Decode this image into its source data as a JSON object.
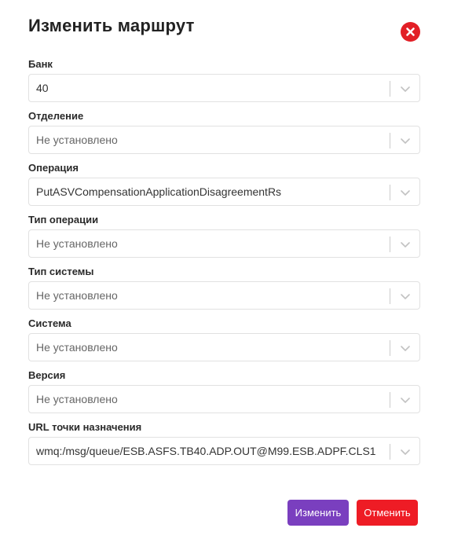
{
  "dialog": {
    "title": "Изменить маршрут",
    "close_icon": "close-icon",
    "accent_colors": {
      "close": "#e21f26",
      "primary": "#7a3fbf",
      "danger": "#ee1c25"
    }
  },
  "fields": [
    {
      "label": "Банк",
      "value": "40"
    },
    {
      "label": "Отделение",
      "placeholder": "Не установлено"
    },
    {
      "label": "Операция",
      "value": "PutASVCompensationApplicationDisagreementRs"
    },
    {
      "label": "Тип операции",
      "placeholder": "Не установлено"
    },
    {
      "label": "Тип системы",
      "placeholder": "Не установлено"
    },
    {
      "label": "Система",
      "placeholder": "Не установлено"
    },
    {
      "label": "Версия",
      "placeholder": "Не установлено"
    },
    {
      "label": "URL точки назначения",
      "value": "wmq:/msg/queue/ESB.ASFS.TB40.ADP.OUT@M99.ESB.ADPF.CLS1"
    }
  ],
  "actions": {
    "submit_label": "Изменить",
    "cancel_label": "Отменить"
  }
}
